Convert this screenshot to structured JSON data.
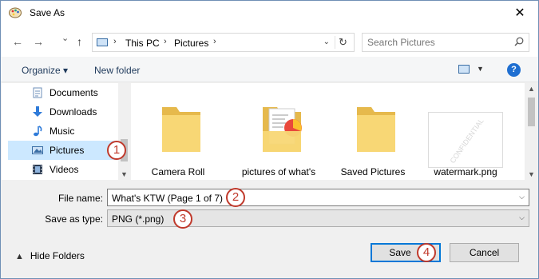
{
  "window": {
    "title": "Save As",
    "close_glyph": "✕"
  },
  "nav": {
    "back": "←",
    "forward": "→",
    "recent": "⌄",
    "up": "↑"
  },
  "address": {
    "crumbs": [
      "This PC",
      "Pictures"
    ],
    "separator": "›",
    "dropdown": "⌄",
    "refresh": "↻"
  },
  "search": {
    "placeholder": "Search Pictures"
  },
  "toolbar": {
    "organize": "Organize ▾",
    "new_folder": "New folder",
    "help": "?"
  },
  "sidebar": {
    "items": [
      {
        "label": "Documents",
        "icon": "documents-icon"
      },
      {
        "label": "Downloads",
        "icon": "downloads-icon"
      },
      {
        "label": "Music",
        "icon": "music-icon"
      },
      {
        "label": "Pictures",
        "icon": "pictures-icon",
        "selected": true
      },
      {
        "label": "Videos",
        "icon": "videos-icon"
      }
    ]
  },
  "files": [
    {
      "name": "Camera Roll",
      "type": "folder"
    },
    {
      "name": "pictures of what's",
      "type": "folder-with-content"
    },
    {
      "name": "Saved Pictures",
      "type": "folder"
    },
    {
      "name": "watermark.png",
      "type": "image",
      "watermark_text": "CONFIDENTIAL"
    }
  ],
  "form": {
    "file_name_label": "File name:",
    "file_name_value": "What's KTW (Page 1 of 7)",
    "save_type_label": "Save as type:",
    "save_type_value": "PNG (*.png)"
  },
  "footer": {
    "hide_folders": "Hide Folders",
    "save": "Save",
    "cancel": "Cancel"
  },
  "annotations": [
    "1",
    "2",
    "3",
    "4"
  ],
  "colors": {
    "accent": "#0078d7",
    "selection": "#cce8ff",
    "annotation": "#c0392b",
    "folder": "#f8d775"
  }
}
